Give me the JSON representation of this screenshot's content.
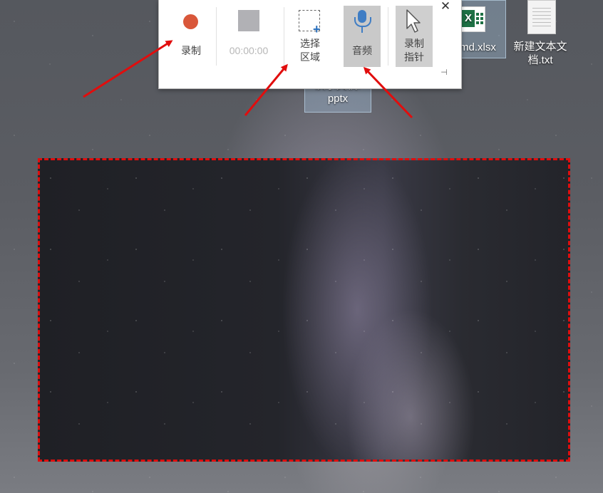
{
  "desktop": {
    "icons": [
      {
        "label": "md.xlsx",
        "type": "excel-file"
      },
      {
        "label": "新建文本文档.txt",
        "type": "text-file"
      },
      {
        "label_partial": "演示文稿.",
        "label_ext": "pptx",
        "type": "powerpoint-file"
      }
    ]
  },
  "toolbar": {
    "record_label": "录制",
    "timer": "00:00:00",
    "select_area_label": "选择区域",
    "audio_label": "音频",
    "record_pointer_label": "录制指针",
    "close_icon": "close-icon",
    "pin_icon": "pin-icon"
  },
  "colors": {
    "record_dot": "#d9573a",
    "mic": "#3f7dc4",
    "annotation_red": "#e10d0d"
  }
}
